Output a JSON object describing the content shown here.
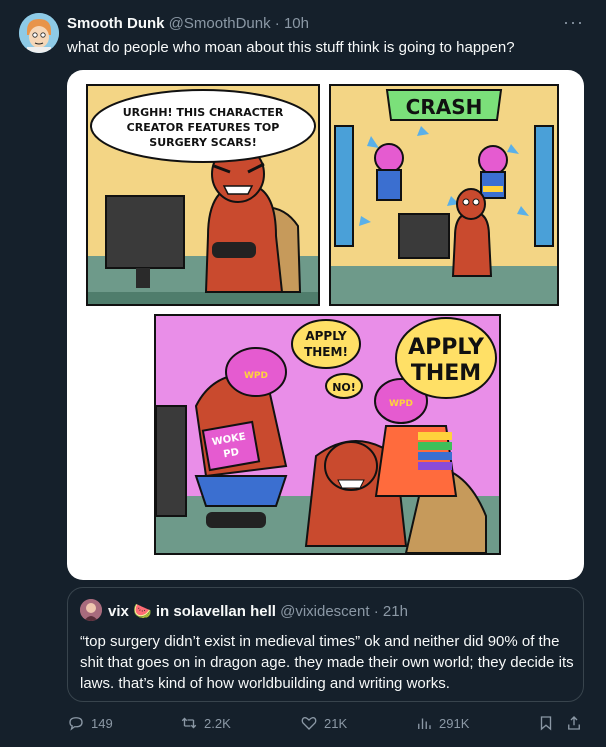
{
  "tweet": {
    "author_name": "Smooth Dunk",
    "author_handle": "@SmoothDunk",
    "separator": "·",
    "time": "10h",
    "more_label": "···",
    "text": "what do people who moan about this stuff think is going to happen?"
  },
  "comic": {
    "panel1_bubble": [
      "URGHH! THIS CHARACTER",
      "CREATOR FEATURES TOP",
      "SURGERY SCARS!"
    ],
    "panel2_sfx": "CRASH",
    "panel3_bubble_left": [
      "APPLY",
      "THEM!"
    ],
    "panel3_bubble_right": [
      "APPLY",
      "THEM"
    ],
    "panel3_no": "NO!",
    "helmet_label": "WPD",
    "box_label": [
      "WOKE",
      "PD"
    ]
  },
  "quote": {
    "author_name": "vix",
    "emoji": "🍉",
    "author_suffix": "in solavellan hell",
    "author_handle": "@vixidescent",
    "separator": "·",
    "time": "21h",
    "text": "“top surgery didn’t exist in medieval times” ok and neither did 90% of the shit that goes on in dragon age. they made their own world; they decide its laws. that’s kind of how worldbuilding and writing works."
  },
  "actions": {
    "replies": "149",
    "retweets": "2.2K",
    "likes": "21K",
    "views": "291K"
  },
  "colors": {
    "background": "#15202b",
    "muted": "#8b98a5",
    "border": "#38444d"
  }
}
